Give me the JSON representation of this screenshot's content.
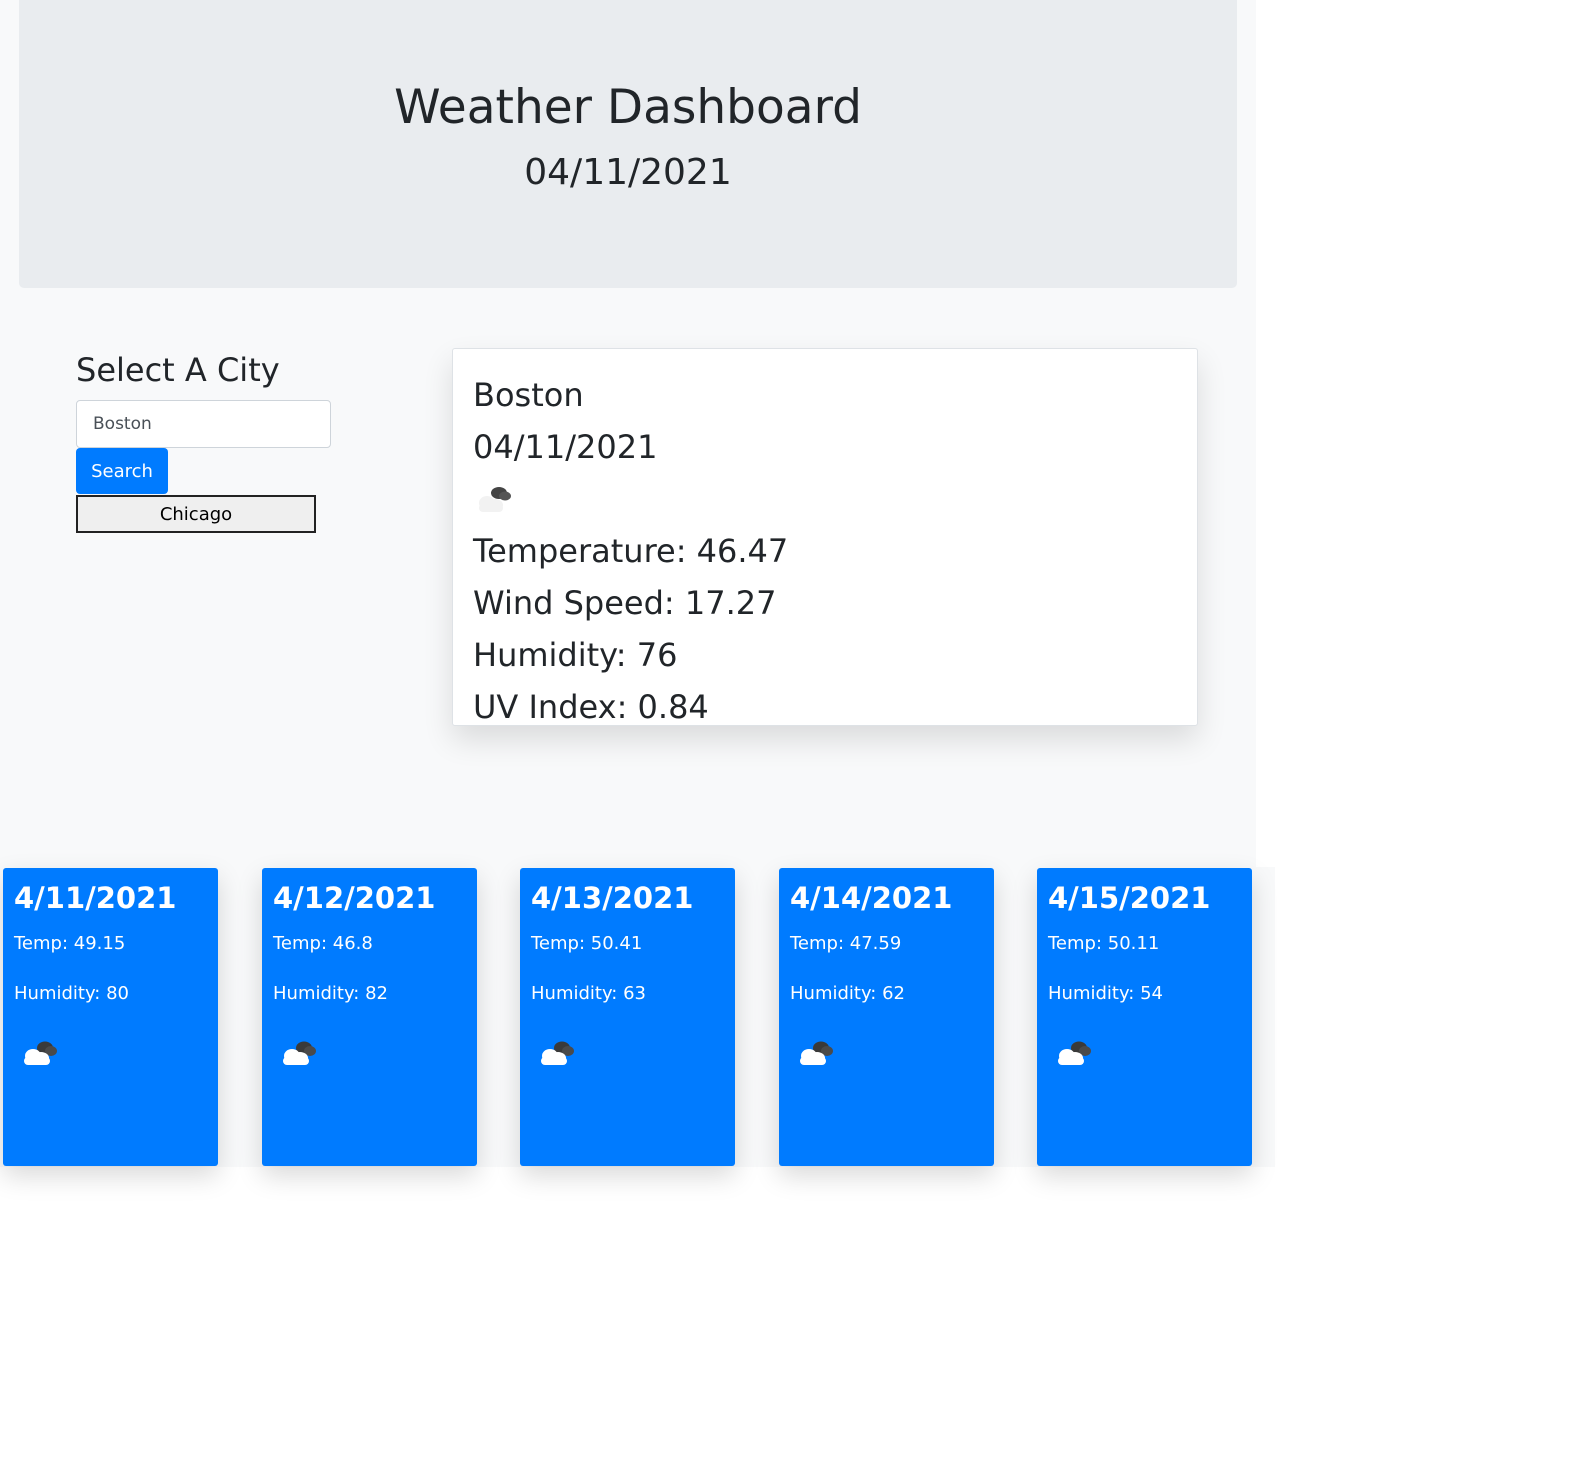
{
  "header": {
    "title": "Weather Dashboard",
    "date": "04/11/2021"
  },
  "search": {
    "heading": "Select A City",
    "input_value": "Boston",
    "button_label": "Search",
    "history": [
      "Chicago"
    ]
  },
  "current": {
    "city": "Boston",
    "date": "04/11/2021",
    "icon": "cloud-icon",
    "temperature": "Temperature: 46.47",
    "wind_speed": "Wind Speed: 17.27",
    "humidity": "Humidity: 76",
    "uv_index": "UV Index: 0.84"
  },
  "forecast": [
    {
      "date": "4/11/2021",
      "temp": "Temp: 49.15",
      "humidity": "Humidity: 80",
      "icon": "cloud-icon"
    },
    {
      "date": "4/12/2021",
      "temp": "Temp: 46.8",
      "humidity": "Humidity: 82",
      "icon": "cloud-icon"
    },
    {
      "date": "4/13/2021",
      "temp": "Temp: 50.41",
      "humidity": "Humidity: 63",
      "icon": "cloud-icon"
    },
    {
      "date": "4/14/2021",
      "temp": "Temp: 47.59",
      "humidity": "Humidity: 62",
      "icon": "cloud-icon"
    },
    {
      "date": "4/15/2021",
      "temp": "Temp: 50.11",
      "humidity": "Humidity: 54",
      "icon": "cloud-icon"
    }
  ],
  "colors": {
    "primary": "#007bff",
    "jumbotron": "#e9ecef",
    "background": "#f8f9fa"
  }
}
